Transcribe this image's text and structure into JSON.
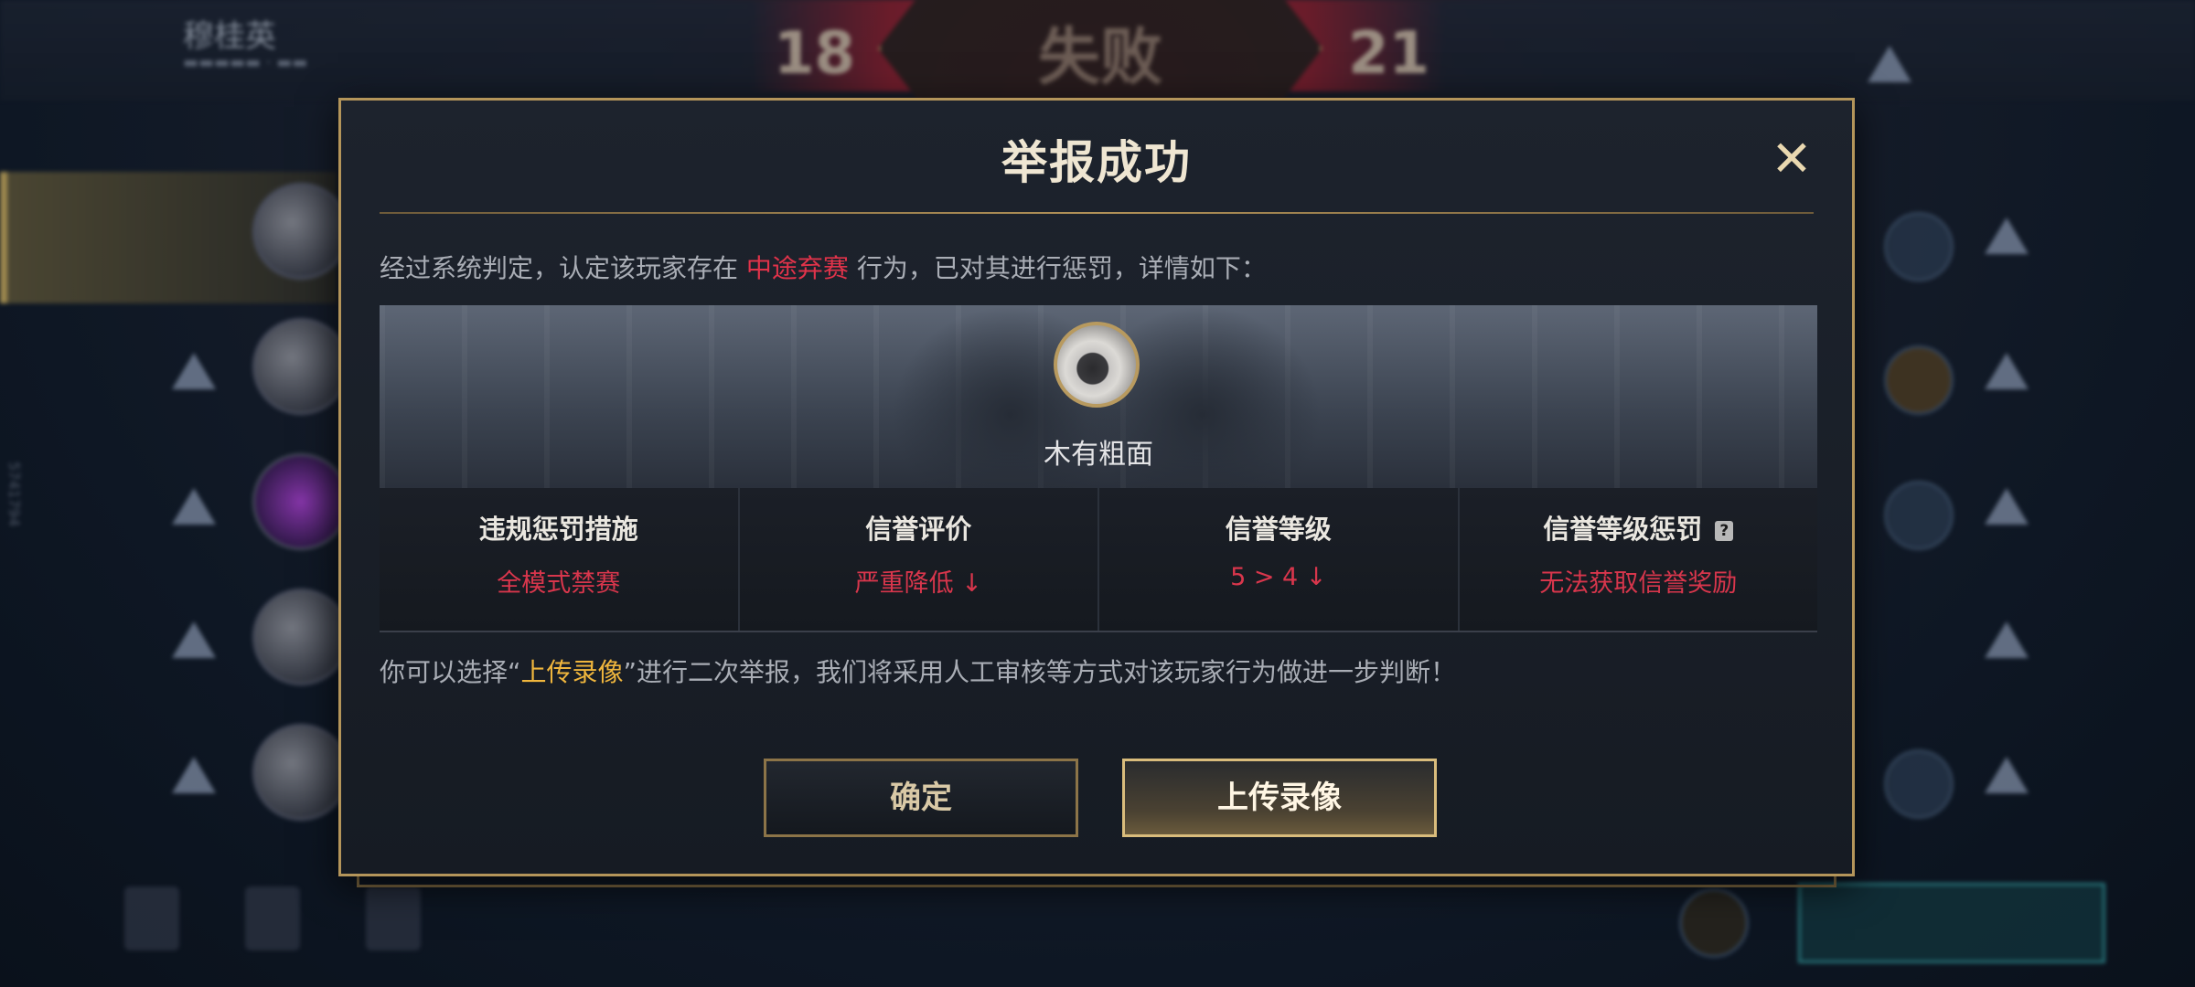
{
  "background": {
    "player_name": "穆桂英",
    "score_left": "18",
    "score_right": "21",
    "result_text": "失败",
    "side_id": "5741794"
  },
  "dialog": {
    "title": "举报成功",
    "close_icon": "✕",
    "verdict_prefix": "经过系统判定，认定该玩家存在 ",
    "verdict_highlight": "中途弃赛",
    "verdict_suffix": " 行为，已对其进行惩罚，详情如下：",
    "user": {
      "name": "木有粗面"
    },
    "stats": [
      {
        "label": "违规惩罚措施",
        "value": "全模式禁赛"
      },
      {
        "label": "信誉评价",
        "value": "严重降低 ↓"
      },
      {
        "label": "信誉等级",
        "value": "5 > 4 ↓"
      },
      {
        "label": "信誉等级惩罚",
        "value": "无法获取信誉奖励",
        "help_icon": "?"
      }
    ],
    "hint_prefix": "你可以选择“",
    "hint_highlight": "上传录像",
    "hint_suffix": "”进行二次举报，我们将采用人工审核等方式对该玩家行为做进一步判断！",
    "confirm_label": "确定",
    "upload_label": "上传录像"
  },
  "colors": {
    "accent_gold": "#b4955a",
    "penalty_red": "#d8364c",
    "highlight_gold": "#f0b63d"
  }
}
